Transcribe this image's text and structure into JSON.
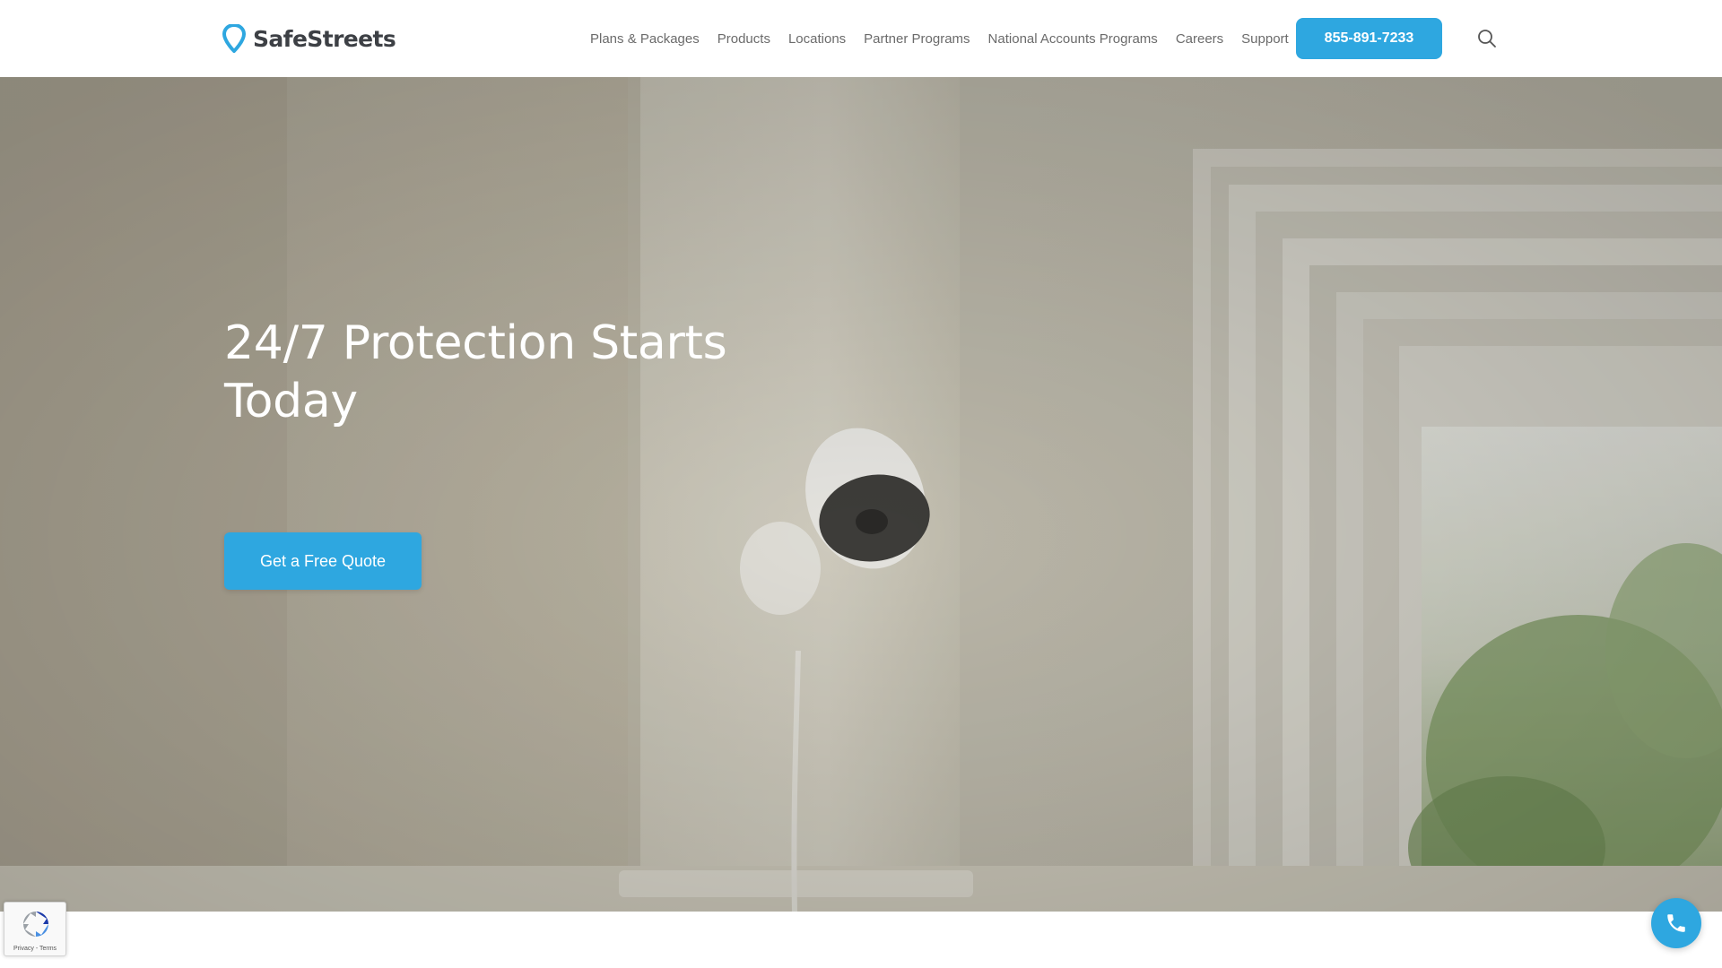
{
  "brand": {
    "name": "SafeStreets",
    "accent_color": "#2ea7e0"
  },
  "nav": {
    "items": [
      {
        "label": "Plans & Packages"
      },
      {
        "label": "Products"
      },
      {
        "label": "Locations"
      },
      {
        "label": "Partner Programs"
      },
      {
        "label": "National Accounts Programs"
      },
      {
        "label": "Careers"
      },
      {
        "label": "Support"
      }
    ],
    "phone_label": "855-891-7233",
    "search_icon": "search-icon"
  },
  "hero": {
    "title": "24/7 Protection Starts Today",
    "cta_label": "Get a Free Quote",
    "image": "indoor-security-camera-on-wall"
  },
  "recaptcha": {
    "label": "Privacy - Terms",
    "icon": "recaptcha-icon"
  },
  "call_fab": {
    "icon": "phone-icon"
  }
}
